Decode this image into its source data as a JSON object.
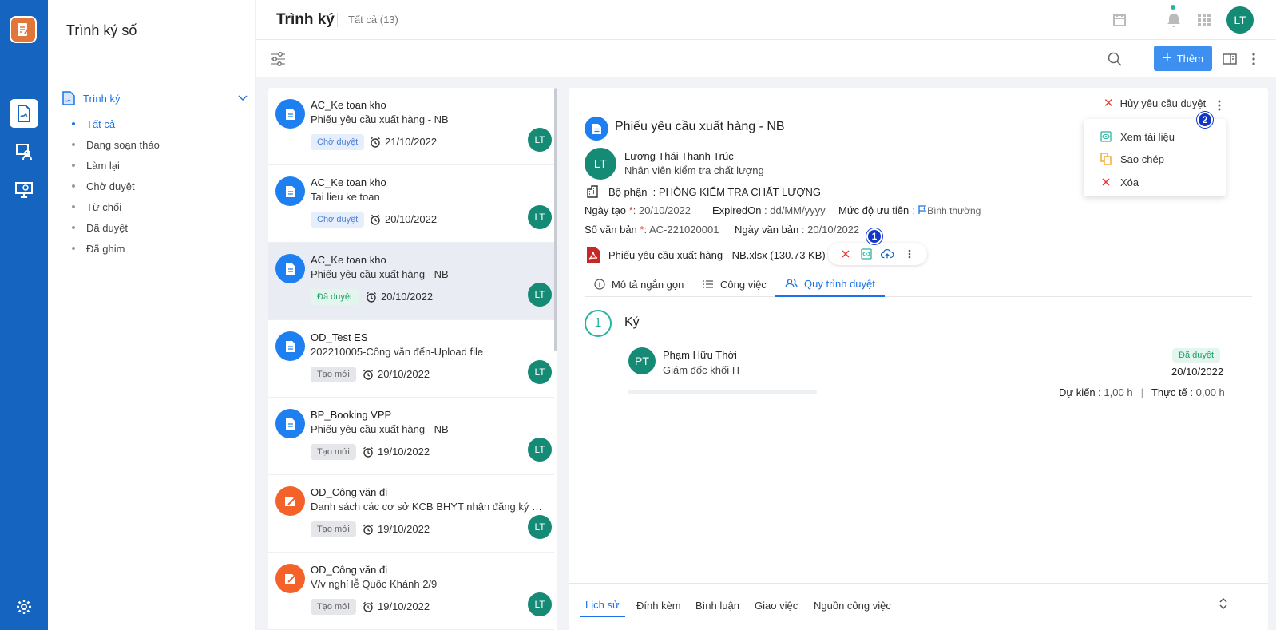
{
  "sidebar": {
    "title": "Trình ký số",
    "group_label": "Trình ký",
    "items": [
      {
        "label": "Tất cả"
      },
      {
        "label": "Đang soạn thảo"
      },
      {
        "label": "Làm lại"
      },
      {
        "label": "Chờ duyệt"
      },
      {
        "label": "Từ chối"
      },
      {
        "label": "Đã duyệt"
      },
      {
        "label": "Đã ghim"
      }
    ]
  },
  "header": {
    "title": "Trình ký",
    "count": "Tất cả (13)",
    "avatar": "LT"
  },
  "toolbar": {
    "add_label": "Thêm"
  },
  "list": {
    "items": [
      {
        "group": "AC_Ke toan kho",
        "title": "Phiếu yêu cầu xuất hàng - NB",
        "status": "Chờ duyệt",
        "date": "21/10/2022",
        "avatar": "LT"
      },
      {
        "group": "AC_Ke toan kho",
        "title": "Tai lieu ke toan",
        "status": "Chờ duyệt",
        "date": "20/10/2022",
        "avatar": "LT"
      },
      {
        "group": "AC_Ke toan kho",
        "title": "Phiếu yêu cầu xuất hàng - NB",
        "status": "Đã duyệt",
        "date": "20/10/2022",
        "avatar": "LT"
      },
      {
        "group": "OD_Test ES",
        "title": "202210005-Công văn đến-Upload file",
        "status": "Tạo mới",
        "date": "20/10/2022",
        "avatar": "LT"
      },
      {
        "group": "BP_Booking VPP",
        "title": "Phiếu yêu cầu xuất hàng - NB",
        "status": "Tạo mới",
        "date": "19/10/2022",
        "avatar": "LT"
      },
      {
        "group": "OD_Công văn đi",
        "title": "Danh sách các cơ sở KCB BHYT nhận đăng ký KCB ban đầu",
        "status": "Tạo mới",
        "date": "19/10/2022",
        "avatar": "LT"
      },
      {
        "group": "OD_Công văn đi",
        "title": "V/v nghỉ lễ Quốc Khánh 2/9",
        "status": "Tạo mới",
        "date": "19/10/2022",
        "avatar": "LT"
      }
    ]
  },
  "detail": {
    "title": "Phiếu yêu cầu xuất hàng - NB",
    "cancel_label": "Hủy yêu cầu duyệt",
    "marker1": "1",
    "marker2": "2",
    "menu": [
      {
        "label": "Xem tài liệu"
      },
      {
        "label": "Sao chép"
      },
      {
        "label": "Xóa"
      }
    ],
    "creator": {
      "avatar": "LT",
      "name": "Lương Thái Thanh Trúc",
      "role": "Nhân viên kiểm tra chất lượng"
    },
    "dept_label": "Bộ phận",
    "dept_value": ": PHÒNG KIỂM TRA CHẤT LƯỢNG",
    "created_label": "Ngày tạo",
    "created_value": ": 20/10/2022",
    "expired_label": "ExpiredOn",
    "expired_value": ": dd/MM/yyyy",
    "priority_label": "Mức độ ưu tiên",
    "priority_value": "Bình thường",
    "docno_label": "Số văn bản",
    "docno_value": ": AC-221020001",
    "docdate_label": "Ngày văn bản",
    "docdate_value": ": 20/10/2022",
    "file_name": "Phiếu yêu cầu xuất hàng - NB.xlsx (130.73 KB)",
    "tabs": [
      {
        "label": "Mô tả ngắn gọn"
      },
      {
        "label": "Công việc"
      },
      {
        "label": "Quy trình duyệt"
      }
    ],
    "step_no": "1",
    "step_label": "Ký",
    "approver": {
      "avatar": "PT",
      "name": "Phạm Hữu Thời",
      "role": "Giám đốc khối IT",
      "status": "Đã duyệt",
      "date": "20/10/2022"
    },
    "eta_label": "Dự kiến :",
    "eta_value": "1,00 h",
    "actual_label": "Thực tế :",
    "actual_value": "0,00 h",
    "bottom_tabs": [
      {
        "label": "Lịch sử"
      },
      {
        "label": "Đính kèm"
      },
      {
        "label": "Bình luận"
      },
      {
        "label": "Giao việc"
      },
      {
        "label": "Nguồn công việc"
      }
    ]
  }
}
